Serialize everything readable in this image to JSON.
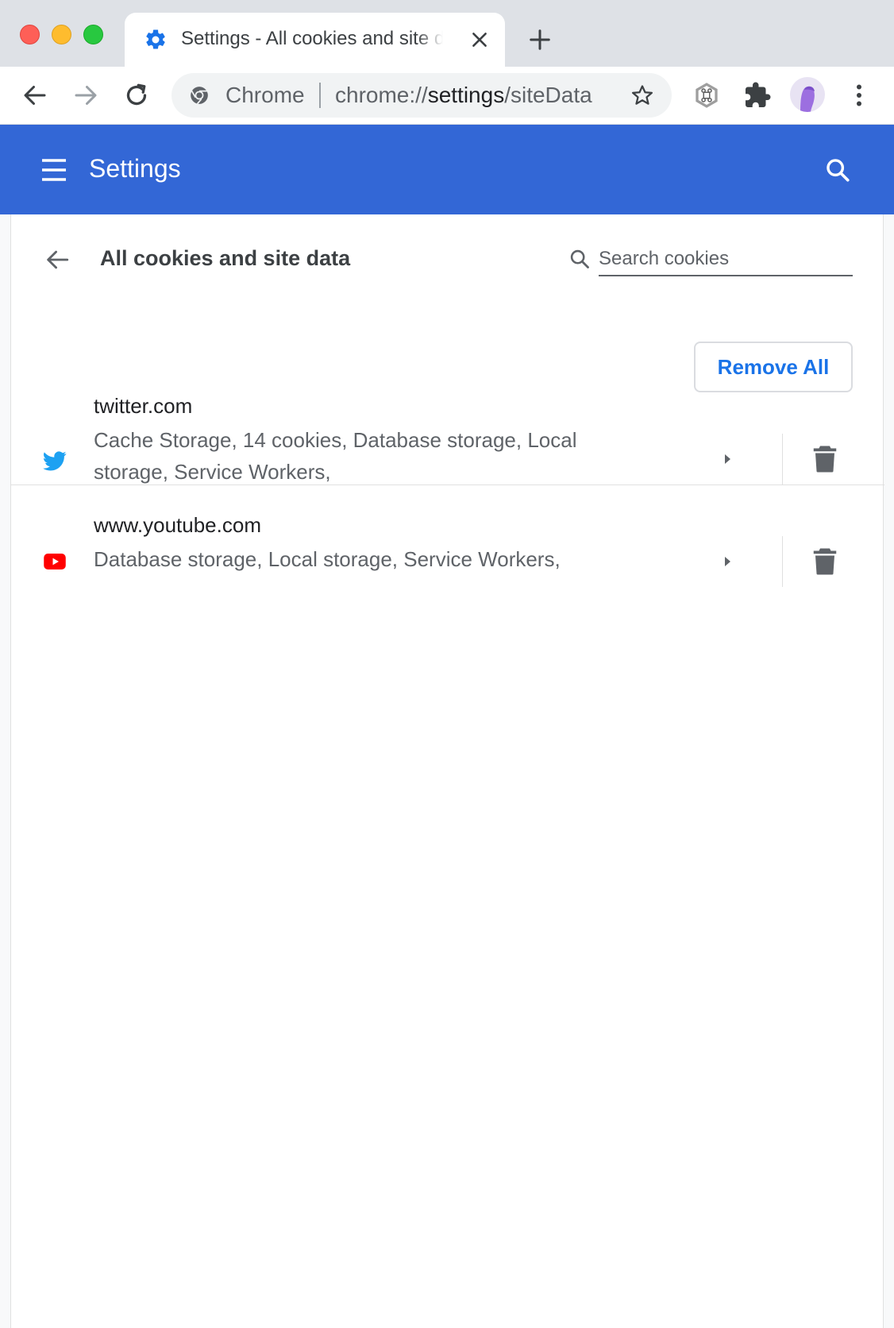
{
  "browser": {
    "tab_title": "Settings - All cookies and site data",
    "omnibox_label": "Chrome",
    "url_prefix": "chrome://",
    "url_host": "settings",
    "url_path": "/siteData"
  },
  "header": {
    "title": "Settings"
  },
  "page": {
    "title": "All cookies and site data",
    "search_placeholder": "Search cookies",
    "remove_all_label": "Remove All"
  },
  "sites": [
    {
      "name": "twitter.com",
      "description": "Cache Storage, 14 cookies, Database storage, Local storage, Service Workers,",
      "icon": "twitter-icon"
    },
    {
      "name": "www.youtube.com",
      "description": "Database storage, Local storage, Service Workers,",
      "icon": "youtube-icon"
    }
  ],
  "colors": {
    "header_blue": "#3367d6",
    "link_blue": "#1a73e8",
    "twitter_blue": "#1da1f2",
    "youtube_red": "#ff0000"
  }
}
